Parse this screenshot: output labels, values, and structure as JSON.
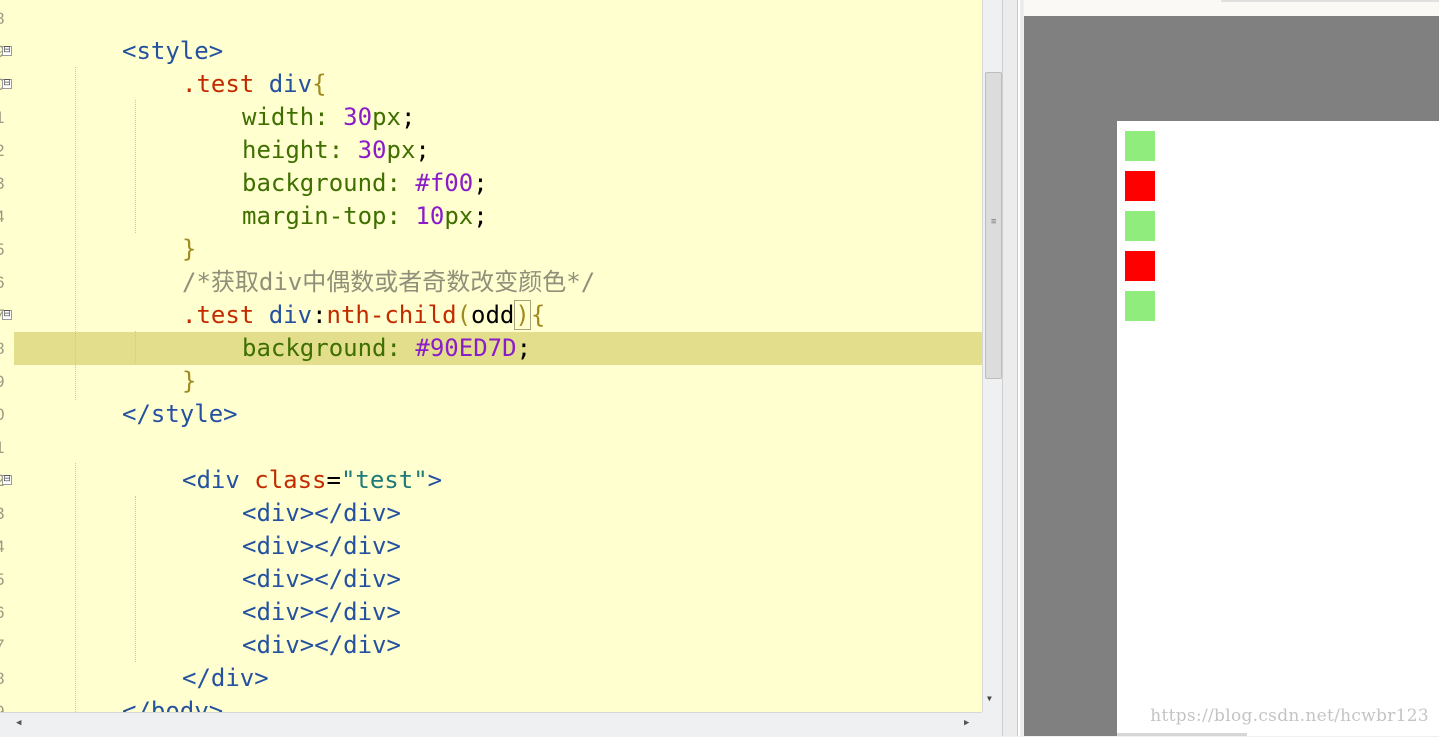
{
  "editor": {
    "lines": [
      {
        "tokens": [
          {
            "text": "<style>",
            "kind": "t"
          }
        ]
      },
      {
        "tokens": [
          {
            "text": ".test",
            "kind": "s"
          },
          {
            "text": " ",
            "kind": "k"
          },
          {
            "text": "div",
            "kind": "t"
          },
          {
            "text": "{",
            "kind": "b"
          }
        ]
      },
      {
        "tokens": [
          {
            "text": "width",
            "kind": "p"
          },
          {
            "text": ": ",
            "kind": "p"
          },
          {
            "text": "30",
            "kind": "n"
          },
          {
            "text": "px",
            "kind": "u"
          },
          {
            "text": ";",
            "kind": "k"
          }
        ]
      },
      {
        "tokens": [
          {
            "text": "height",
            "kind": "p"
          },
          {
            "text": ": ",
            "kind": "p"
          },
          {
            "text": "30",
            "kind": "n"
          },
          {
            "text": "px",
            "kind": "u"
          },
          {
            "text": ";",
            "kind": "k"
          }
        ]
      },
      {
        "tokens": [
          {
            "text": "background",
            "kind": "p"
          },
          {
            "text": ": ",
            "kind": "p"
          },
          {
            "text": "#f00",
            "kind": "n"
          },
          {
            "text": ";",
            "kind": "k"
          }
        ]
      },
      {
        "tokens": [
          {
            "text": "margin-top",
            "kind": "p"
          },
          {
            "text": ": ",
            "kind": "p"
          },
          {
            "text": "10",
            "kind": "n"
          },
          {
            "text": "px",
            "kind": "u"
          },
          {
            "text": ";",
            "kind": "k"
          }
        ]
      },
      {
        "tokens": [
          {
            "text": "}",
            "kind": "b"
          }
        ]
      },
      {
        "tokens": [
          {
            "text": "/*获取div中偶数或者奇数改变颜色*/",
            "kind": "c"
          }
        ]
      },
      {
        "tokens": [
          {
            "text": ".test",
            "kind": "s"
          },
          {
            "text": " ",
            "kind": "k"
          },
          {
            "text": "div",
            "kind": "t"
          },
          {
            "text": ":",
            "kind": "k"
          },
          {
            "text": "nth-child",
            "kind": "s"
          },
          {
            "text": "(",
            "kind": "b"
          },
          {
            "text": "odd",
            "kind": "k"
          },
          {
            "text": ")",
            "kind": "b",
            "boxed": true
          },
          {
            "text": "{",
            "kind": "b"
          }
        ]
      },
      {
        "tokens": [
          {
            "text": "background",
            "kind": "p"
          },
          {
            "text": ": ",
            "kind": "p"
          },
          {
            "text": "#90ED7D",
            "kind": "n"
          },
          {
            "text": ";",
            "kind": "k"
          }
        ]
      },
      {
        "tokens": [
          {
            "text": "}",
            "kind": "b"
          }
        ]
      },
      {
        "tokens": [
          {
            "text": "</style>",
            "kind": "t"
          }
        ]
      },
      {
        "tokens": []
      },
      {
        "tokens": [
          {
            "text": "<div",
            "kind": "t"
          },
          {
            "text": " ",
            "kind": "k"
          },
          {
            "text": "class",
            "kind": "a"
          },
          {
            "text": "=",
            "kind": "k"
          },
          {
            "text": "\"test\"",
            "kind": "v"
          },
          {
            "text": ">",
            "kind": "t"
          }
        ]
      },
      {
        "tokens": [
          {
            "text": "<div></div>",
            "kind": "t"
          }
        ]
      },
      {
        "tokens": [
          {
            "text": "<div></div>",
            "kind": "t"
          }
        ]
      },
      {
        "tokens": [
          {
            "text": "<div></div>",
            "kind": "t"
          }
        ]
      },
      {
        "tokens": [
          {
            "text": "<div></div>",
            "kind": "t"
          }
        ]
      },
      {
        "tokens": [
          {
            "text": "<div></div>",
            "kind": "t"
          }
        ]
      },
      {
        "tokens": [
          {
            "text": "</div>",
            "kind": "t"
          }
        ]
      },
      {
        "tokens": [
          {
            "text": "</body>",
            "kind": "t"
          }
        ]
      }
    ],
    "gutter_digits": [
      "8",
      "9",
      "0",
      "1",
      "2",
      "3",
      "4",
      "5",
      "6",
      "7",
      "8",
      "9",
      "0",
      "1",
      "2",
      "3",
      "4",
      "5",
      "6",
      "7",
      "8",
      "9"
    ],
    "fold_marker": "⊟",
    "highlighted_line": 9
  },
  "preview": {
    "boxes": [
      {
        "color": "#90ED7D"
      },
      {
        "color": "#ff0000"
      },
      {
        "color": "#90ED7D"
      },
      {
        "color": "#ff0000"
      },
      {
        "color": "#90ED7D"
      }
    ],
    "watermark": "https://blog.csdn.net/hcwbr123"
  },
  "icons": {
    "scroll_down": "triangle-down",
    "scroll_left": "triangle-left",
    "scroll_right": "triangle-right"
  }
}
